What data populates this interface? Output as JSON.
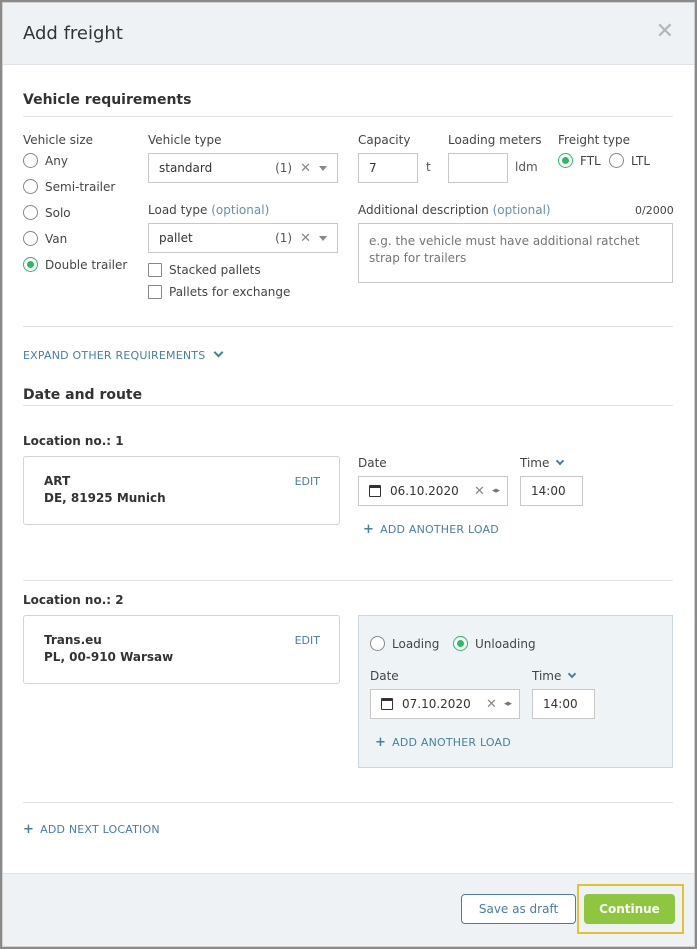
{
  "dialog": {
    "title": "Add freight"
  },
  "vehicle": {
    "section_title": "Vehicle requirements",
    "size_label": "Vehicle size",
    "sizes": [
      "Any",
      "Semi-trailer",
      "Solo",
      "Van",
      "Double trailer"
    ],
    "selected_size": "Double trailer",
    "type_label": "Vehicle type",
    "type_value": "standard",
    "type_count": "(1)",
    "load_type_label": "Load type",
    "load_type_optional": "(optional)",
    "load_type_value": "pallet",
    "load_type_count": "(1)",
    "checkboxes": [
      "Stacked pallets",
      "Pallets for exchange"
    ],
    "capacity_label": "Capacity",
    "capacity_value": "7",
    "capacity_unit": "t",
    "loading_meters_label": "Loading meters",
    "loading_meters_value": "",
    "loading_meters_unit": "ldm",
    "freight_type_label": "Freight type",
    "freight_types": [
      "FTL",
      "LTL"
    ],
    "selected_freight_type": "FTL",
    "desc_label": "Additional description",
    "desc_optional": "(optional)",
    "desc_counter": "0/2000",
    "desc_placeholder": "e.g. the vehicle must have additional ratchet strap for trailers",
    "expand_label": "EXPAND OTHER REQUIREMENTS"
  },
  "route": {
    "section_title": "Date and route",
    "date_label": "Date",
    "time_label": "Time",
    "add_load_label": "ADD ANOTHER LOAD",
    "edit_label": "EDIT",
    "locations": [
      {
        "title": "Location no.: 1",
        "name": "ART",
        "address": "DE, 81925 Munich",
        "date": "06.10.2020",
        "time": "14:00"
      },
      {
        "title": "Location no.: 2",
        "name": "Trans.eu",
        "address": "PL, 00-910 Warsaw",
        "date": "07.10.2020",
        "time": "14:00",
        "mode_options": [
          "Loading",
          "Unloading"
        ],
        "selected_mode": "Unloading"
      }
    ],
    "add_location_label": "ADD NEXT LOCATION"
  },
  "footer": {
    "draft_label": "Save as draft",
    "continue_label": "Continue"
  },
  "colors": {
    "accent_green": "#2eb862",
    "button_green": "#8ec63f",
    "link_blue": "#4a7f9c",
    "highlight": "#e2c233"
  },
  "icons": {
    "close": "close-icon",
    "calendar": "calendar-icon",
    "chevron": "chevron-down-icon",
    "plus": "plus-icon"
  }
}
